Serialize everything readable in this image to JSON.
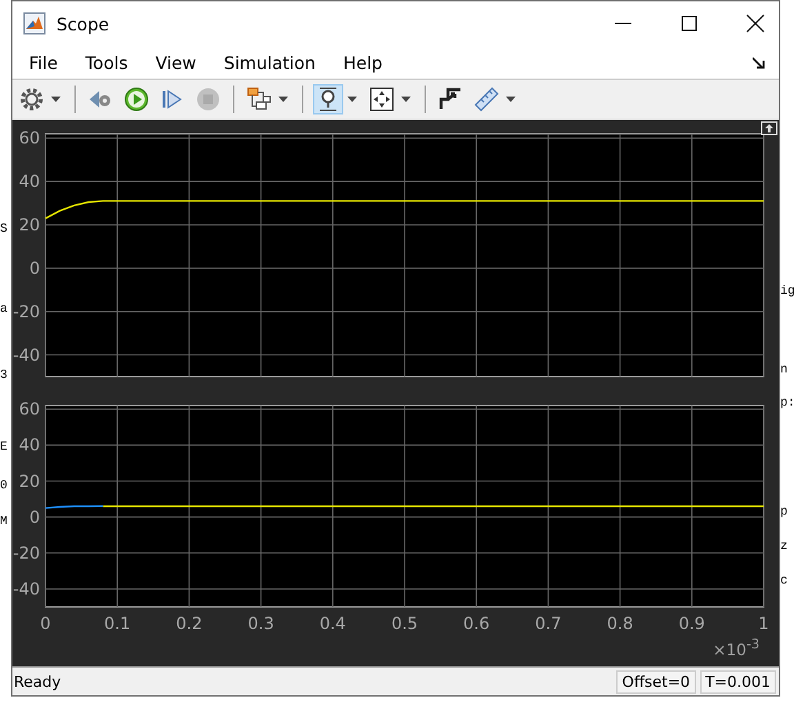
{
  "background": {
    "left_texts": [
      "S",
      "a",
      "3",
      "E",
      "0",
      "M"
    ],
    "right_texts": [
      "ig",
      "n",
      "p:",
      "p",
      "z",
      "c"
    ]
  },
  "window": {
    "title": "Scope"
  },
  "menu": [
    {
      "label": "File"
    },
    {
      "label": "Tools"
    },
    {
      "label": "View"
    },
    {
      "label": "Simulation"
    },
    {
      "label": "Help"
    }
  ],
  "toolbar": [
    {
      "kind": "settings",
      "dropdown": true,
      "selected": false,
      "disabled": false
    },
    {
      "kind": "separator"
    },
    {
      "kind": "step_back",
      "dropdown": false,
      "selected": false,
      "disabled": false
    },
    {
      "kind": "run",
      "dropdown": false,
      "selected": false,
      "disabled": false
    },
    {
      "kind": "step_forward",
      "dropdown": false,
      "selected": false,
      "disabled": false
    },
    {
      "kind": "stop",
      "dropdown": false,
      "selected": false,
      "disabled": true
    },
    {
      "kind": "separator"
    },
    {
      "kind": "signals",
      "dropdown": true,
      "selected": false,
      "disabled": false
    },
    {
      "kind": "separator"
    },
    {
      "kind": "zoom",
      "dropdown": true,
      "selected": true,
      "disabled": false
    },
    {
      "kind": "fit",
      "dropdown": true,
      "selected": false,
      "disabled": false
    },
    {
      "kind": "separator"
    },
    {
      "kind": "triggers",
      "dropdown": false,
      "selected": false,
      "disabled": false
    },
    {
      "kind": "measure",
      "dropdown": true,
      "selected": false,
      "disabled": false
    }
  ],
  "plots": [
    {
      "chart_data": {
        "type": "line",
        "x": [
          0,
          0.02,
          0.04,
          0.06,
          0.08,
          0.1,
          0.2,
          0.3,
          0.4,
          0.5,
          0.6,
          0.7,
          0.8,
          0.9,
          1
        ],
        "xlim": [
          0,
          1
        ],
        "ylim": [
          -50,
          62
        ],
        "yticks": [
          60,
          40,
          20,
          0,
          -20,
          -40
        ],
        "grid": true,
        "series": [
          {
            "color": "#e6e600",
            "values": [
              23,
              26.5,
              29,
              30.5,
              31,
              31,
              31,
              31,
              31,
              31,
              31,
              31,
              31,
              31,
              31
            ]
          }
        ]
      }
    },
    {
      "chart_data": {
        "type": "line",
        "x": [
          0,
          0.02,
          0.04,
          0.06,
          0.08,
          0.1,
          0.2,
          0.3,
          0.4,
          0.5,
          0.6,
          0.7,
          0.8,
          0.9,
          1
        ],
        "xlim": [
          0,
          1
        ],
        "ylim": [
          -50,
          62
        ],
        "xticks": [
          0,
          0.1,
          0.2,
          0.3,
          0.4,
          0.5,
          0.6,
          0.7,
          0.8,
          0.9,
          1
        ],
        "yticks": [
          60,
          40,
          20,
          0,
          -20,
          -40
        ],
        "grid": true,
        "series": [
          {
            "color": "#e6e600",
            "values": [
              null,
              null,
              null,
              null,
              6,
              6,
              6,
              6,
              6,
              6,
              6,
              6,
              6,
              6,
              6
            ]
          },
          {
            "color": "#1e90ff",
            "values": [
              5,
              5.6,
              6,
              6,
              6.1,
              null,
              null,
              null,
              null,
              null,
              null,
              null,
              null,
              null,
              null
            ]
          }
        ]
      }
    }
  ],
  "x_multiplier": "×10$^{-3}$",
  "status_bar": {
    "text": "Ready",
    "fields": [
      "Offset=0",
      "T=0.001"
    ]
  }
}
